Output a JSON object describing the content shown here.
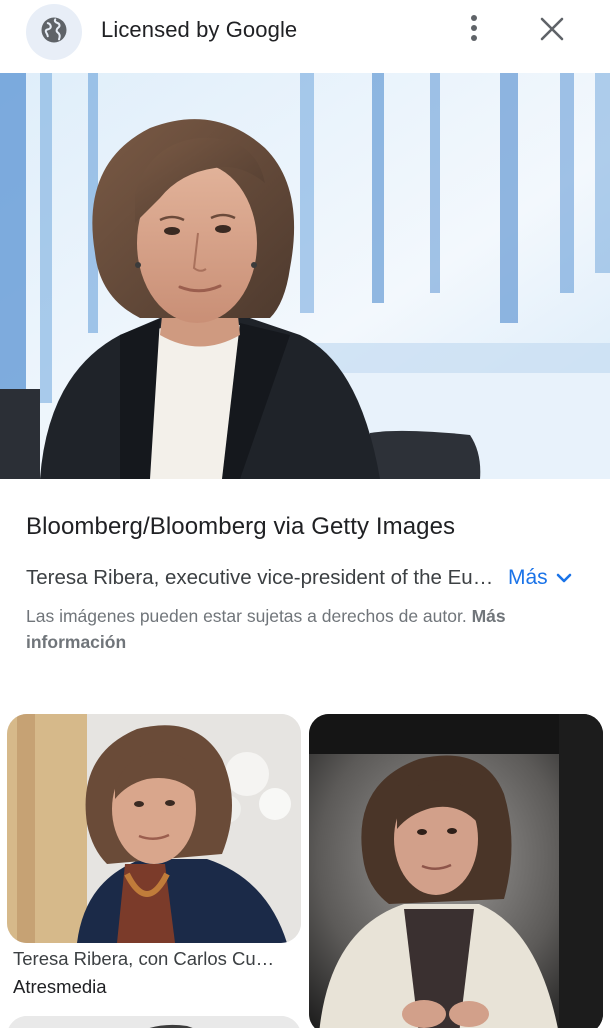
{
  "header": {
    "title": "Licensed by Google",
    "globe_icon": "globe-icon",
    "menu_icon": "more-vert-icon",
    "close_icon": "close-icon"
  },
  "main_image": {
    "source": "Bloomberg/Bloomberg via Getty Images",
    "caption": "Teresa Ribera, executive vice-president of the European Commission",
    "more_label": "Más",
    "copyright_text": "Las imágenes pueden estar sujetas a derechos de autor.",
    "copyright_link": "Más información"
  },
  "related": [
    {
      "title": "Teresa Ribera, con Carlos Cuerpo",
      "source": "Atresmedia"
    },
    {
      "title": "",
      "source": ""
    }
  ],
  "colors": {
    "link": "#1a73e8",
    "globe_bg": "#e8eef7",
    "text_primary": "#202124",
    "text_secondary": "#70757a"
  }
}
